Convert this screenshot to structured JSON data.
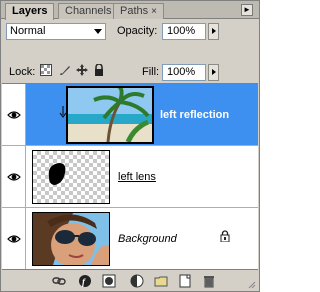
{
  "tabs": [
    {
      "label": "Layers",
      "active": true
    },
    {
      "label": "Channels",
      "active": false
    },
    {
      "label": "Paths",
      "active": false
    }
  ],
  "tab_close_glyph": "×",
  "panel_menu_glyph": "►",
  "blend_mode": {
    "value": "Normal"
  },
  "opacity": {
    "label": "Opacity:",
    "value": "100%"
  },
  "lock": {
    "label": "Lock:"
  },
  "fill": {
    "label": "Fill:",
    "value": "100%"
  },
  "layers": [
    {
      "name": "left reflection",
      "selected": true,
      "visible": true,
      "clipped": true
    },
    {
      "name": "left lens",
      "selected": false,
      "visible": true,
      "underline": true
    },
    {
      "name": "Background",
      "selected": false,
      "visible": true,
      "italic": true,
      "locked": true
    }
  ],
  "toolbar_icons": [
    "link-layers-icon",
    "layer-style-icon",
    "layer-mask-icon",
    "adjustment-layer-icon",
    "new-group-icon",
    "new-layer-icon",
    "delete-layer-icon"
  ],
  "colors": {
    "selection": "#3d8ff0",
    "panel": "#d4d0c8"
  }
}
